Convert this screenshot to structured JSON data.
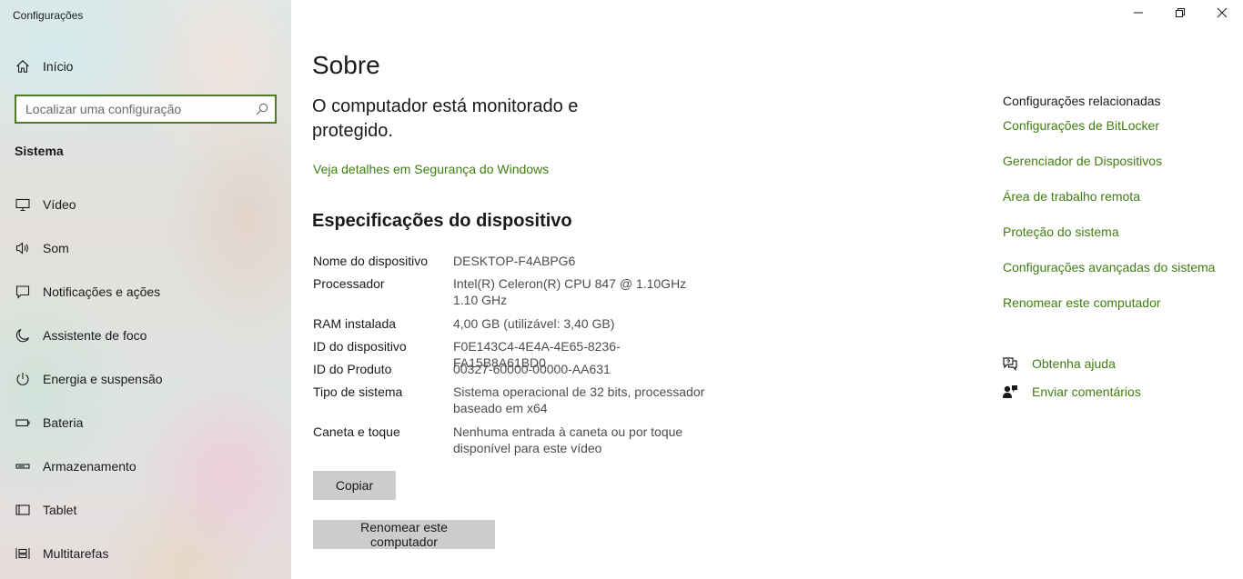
{
  "window": {
    "title": "Configurações",
    "controls": [
      "minimize-icon",
      "restore-icon",
      "close-icon"
    ]
  },
  "sidebar": {
    "home_label": "Início",
    "search": {
      "placeholder": "Localizar uma configuração",
      "value": ""
    },
    "section_title": "Sistema",
    "items": [
      {
        "label": "Vídeo",
        "icon": "monitor-icon"
      },
      {
        "label": "Som",
        "icon": "speaker-icon"
      },
      {
        "label": "Notificações e ações",
        "icon": "notification-icon"
      },
      {
        "label": "Assistente de foco",
        "icon": "moon-icon"
      },
      {
        "label": "Energia e suspensão",
        "icon": "power-icon"
      },
      {
        "label": "Bateria",
        "icon": "battery-icon"
      },
      {
        "label": "Armazenamento",
        "icon": "storage-icon"
      },
      {
        "label": "Tablet",
        "icon": "tablet-icon"
      },
      {
        "label": "Multitarefas",
        "icon": "multitask-icon"
      }
    ]
  },
  "main": {
    "title": "Sobre",
    "protection_text": "O computador está monitorado e protegido.",
    "security_link": "Veja detalhes em Segurança do Windows",
    "specs_heading": "Especificações do dispositivo",
    "specs": [
      {
        "key": "Nome do dispositivo",
        "value": "DESKTOP-F4ABPG6"
      },
      {
        "key": "Processador",
        "value": "Intel(R) Celeron(R) CPU 847 @ 1.10GHz   1.10 GHz"
      },
      {
        "key": "RAM instalada",
        "value": "4,00 GB (utilizável: 3,40 GB)"
      },
      {
        "key": "ID do dispositivo",
        "value": "F0E143C4-4E4A-4E65-8236-FA15B8A61BD0"
      },
      {
        "key": "ID do Produto",
        "value": "00327-60000-00000-AA631"
      },
      {
        "key": "Tipo de sistema",
        "value": "Sistema operacional de 32 bits, processador baseado em x64"
      },
      {
        "key": "Caneta e toque",
        "value": "Nenhuma entrada à caneta ou por toque disponível para este vídeo"
      }
    ],
    "copy_button": "Copiar",
    "rename_button": "Renomear este computador"
  },
  "related": {
    "heading": "Configurações relacionadas",
    "links": [
      "Configurações de BitLocker",
      "Gerenciador de Dispositivos",
      "Área de trabalho remota",
      "Proteção do sistema",
      "Configurações avançadas do sistema",
      "Renomear este computador"
    ],
    "help_label": "Obtenha ajuda",
    "feedback_label": "Enviar comentários"
  },
  "colors": {
    "accent": "#3f7d12",
    "search_border": "#4f7a28",
    "button_bg": "#cccccc"
  }
}
